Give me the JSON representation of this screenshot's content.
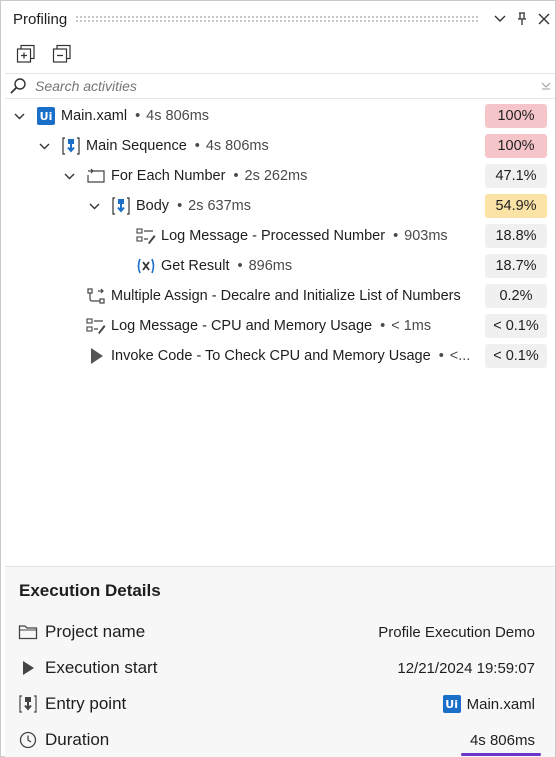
{
  "panel": {
    "title": "Profiling"
  },
  "search": {
    "placeholder": "Search activities"
  },
  "tree": [
    {
      "name": "Main.xaml",
      "duration": "4s 806ms",
      "percent": "100%",
      "level": "hot",
      "icon": "uipath-icon"
    },
    {
      "name": "Main Sequence",
      "duration": "4s 806ms",
      "percent": "100%",
      "level": "hot",
      "icon": "sequence-icon"
    },
    {
      "name": "For Each Number",
      "duration": "2s 262ms",
      "percent": "47.1%",
      "level": "neutral",
      "icon": "foreach-icon"
    },
    {
      "name": "Body",
      "duration": "2s 637ms",
      "percent": "54.9%",
      "level": "warm",
      "icon": "sequence-icon"
    },
    {
      "name": "Log Message - Processed Number",
      "duration": "903ms",
      "percent": "18.8%",
      "level": "neutral",
      "icon": "log-message-icon"
    },
    {
      "name": "Get Result",
      "duration": "896ms",
      "percent": "18.7%",
      "level": "neutral",
      "icon": "variable-icon"
    },
    {
      "name": "Multiple Assign - Decalre and Initialize List of Numbers",
      "duration": "",
      "percent": "0.2%",
      "level": "neutral",
      "icon": "multiple-assign-icon"
    },
    {
      "name": "Log Message - CPU and Memory Usage",
      "duration": "< 1ms",
      "percent": "< 0.1%",
      "level": "neutral",
      "icon": "log-message-icon"
    },
    {
      "name": "Invoke Code - To Check CPU and Memory Usage",
      "duration": "<...",
      "percent": "< 0.1%",
      "level": "neutral",
      "icon": "play-icon"
    }
  ],
  "details": {
    "heading": "Execution Details",
    "project_name_label": "Project name",
    "project_name_value": "Profile Execution Demo",
    "execution_start_label": "Execution start",
    "execution_start_value": "12/21/2024 19:59:07",
    "entry_point_label": "Entry point",
    "entry_point_value": "Main.xaml",
    "duration_label": "Duration",
    "duration_value": "4s 806ms"
  },
  "colors": {
    "hot": "#f6c5c9",
    "warm": "#fbe3a6",
    "neutral": "#f0f0f0",
    "accent": "#1a6fc9",
    "duration_underline": "#6a36c9"
  }
}
